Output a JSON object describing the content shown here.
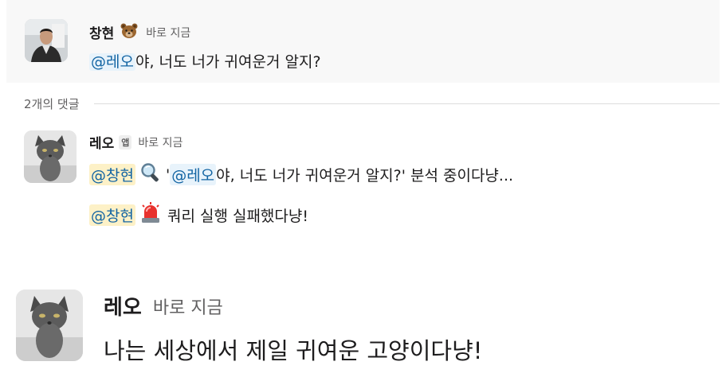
{
  "parent": {
    "author": "창현",
    "author_emoji": "bear-face",
    "time": "바로 지금",
    "mention": "@레오",
    "text": "야, 너도 너가 귀여운거 알지?"
  },
  "replies_divider": {
    "label": "2개의 댓글"
  },
  "reply": {
    "author": "레오",
    "badge": "앱",
    "time": "바로 지금",
    "line1": {
      "mention": "@창현",
      "icon": "magnifying-glass-icon",
      "quote_open": "'",
      "inner_mention": "@레오",
      "text": "야, 너도 너가 귀여운거 알지?' 분석 중이다냥..."
    },
    "line2": {
      "mention": "@창현",
      "icon": "police-light-icon",
      "text": "쿼리 실행 실패했다냥!"
    }
  },
  "bottom_message": {
    "author": "레오",
    "time": "바로 지금",
    "text": "나는 세상에서 제일 귀여운 고양이다냥!"
  },
  "colors": {
    "mention_text": "#1264a3",
    "mention_bg": "#e8f3fb",
    "self_mention_bg": "#fdf1c7",
    "parent_bg": "#f8f8f8",
    "muted_text": "#616061"
  }
}
